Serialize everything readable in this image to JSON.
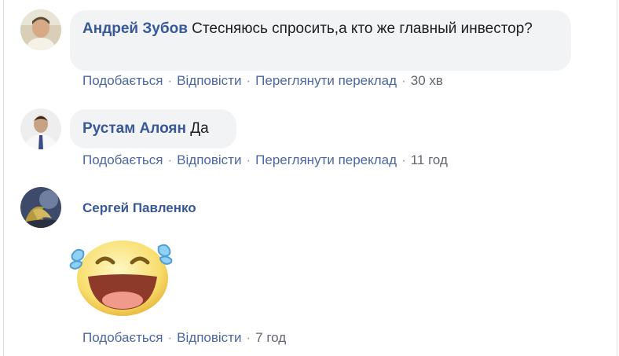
{
  "comments": [
    {
      "author": "Андрей Зубов",
      "text": "Стесняюсь спросить,а кто же главный инвестор?",
      "actions": {
        "like": "Подобається",
        "reply": "Відповісти",
        "translate": "Переглянути переклад",
        "time": "30 хв"
      }
    },
    {
      "author": "Рустам Алоян",
      "text": "Да",
      "actions": {
        "like": "Подобається",
        "reply": "Відповісти",
        "translate": "Переглянути переклад",
        "time": "11 год"
      }
    },
    {
      "author": "Сергей Павленко",
      "sticker": "laughing-with-tears-sticker",
      "actions": {
        "like": "Подобається",
        "reply": "Відповісти",
        "time": "7 год"
      }
    }
  ],
  "separator": "·",
  "colors": {
    "link": "#385898",
    "bubble": "#f2f3f5",
    "meta": "#606770"
  }
}
